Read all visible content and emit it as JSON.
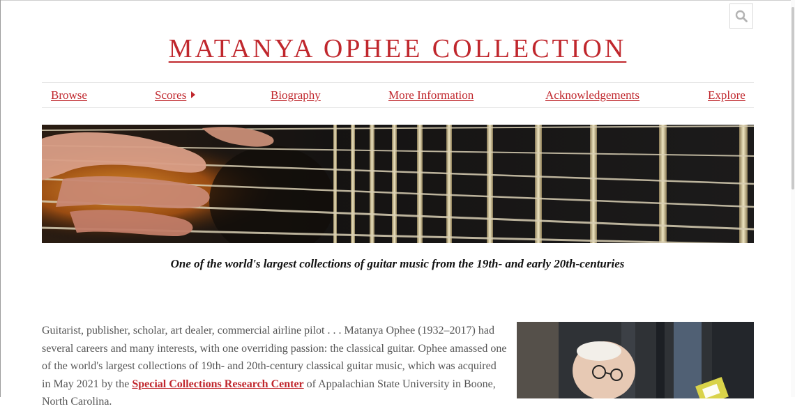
{
  "site": {
    "title": "MATANYA OPHEE COLLECTION"
  },
  "search": {
    "icon": "search-icon"
  },
  "nav": {
    "items": [
      {
        "label": "Browse",
        "has_submenu": false
      },
      {
        "label": "Scores",
        "has_submenu": true
      },
      {
        "label": "Biography",
        "has_submenu": false
      },
      {
        "label": "More Information",
        "has_submenu": false
      },
      {
        "label": "Acknowledgements",
        "has_submenu": false
      },
      {
        "label": "Explore",
        "has_submenu": false
      }
    ]
  },
  "hero": {
    "tagline": "One of the world's largest collections of guitar music from the 19th- and early 20th-centuries"
  },
  "intro": {
    "text_1": "Guitarist, publisher, scholar, art dealer, commercial airline pilot . . . Matanya Ophee (1932–2017) had several careers and many interests, with one overriding passion: the classical guitar. Ophee amassed one of the world's largest collections of 19th- and 20th-century classical guitar music, which was acquired in May 2021 by the ",
    "link": "Special Collections Research Center",
    "text_2": " of Appalachian State University in Boone, North Carolina."
  },
  "colors": {
    "accent": "#c0272d",
    "text": "#555555"
  }
}
